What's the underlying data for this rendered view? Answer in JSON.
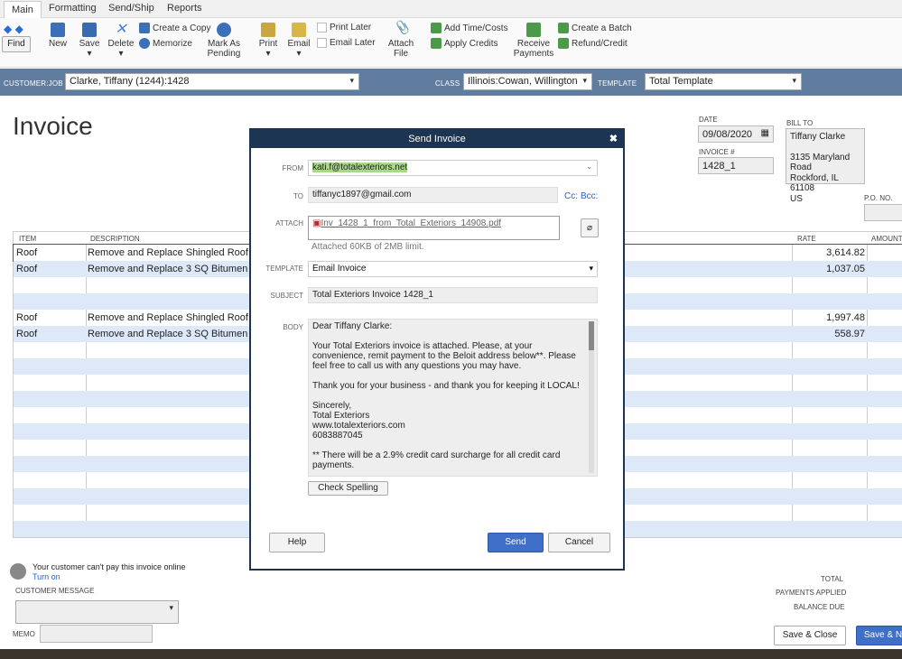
{
  "tabs": [
    "Main",
    "Formatting",
    "Send/Ship",
    "Reports"
  ],
  "ribbon": {
    "find": "Find",
    "new": "New",
    "save": "Save",
    "delete": "Delete",
    "create_copy": "Create a Copy",
    "memorize": "Memorize",
    "mark_pending": "Mark As Pending",
    "print": "Print",
    "email": "Email",
    "print_later": "Print Later",
    "email_later": "Email Later",
    "attach_file": "Attach File",
    "add_time": "Add Time/Costs",
    "apply_credits": "Apply Credits",
    "receive_payments": "Receive Payments",
    "create_batch": "Create a Batch",
    "refund_credit": "Refund/Credit"
  },
  "customer_bar": {
    "customer_job_label": "CUSTOMER:JOB",
    "customer_job": "Clarke, Tiffany (1244):1428",
    "class_label": "CLASS",
    "class": "Illinois:Cowan, Willington",
    "template_label": "TEMPLATE",
    "template": "Total Template"
  },
  "invoice": {
    "title": "Invoice",
    "date_label": "DATE",
    "date": "09/08/2020",
    "invoice_no_label": "INVOICE #",
    "invoice_no": "1428_1",
    "bill_to_label": "BILL TO",
    "bill_to": [
      "Tiffany Clarke",
      "",
      "3135 Maryland Road",
      "Rockford, IL 61108",
      "US"
    ],
    "po_label": "P.O. NO."
  },
  "table": {
    "headers": {
      "item": "ITEM",
      "description": "DESCRIPTION",
      "rate": "RATE",
      "amount": "AMOUNT"
    },
    "rows": [
      {
        "item": "Roof",
        "description": "Remove and Replace Shingled Roof. Inst",
        "rate": "3,614.82"
      },
      {
        "item": "Roof",
        "description": "Remove and Replace 3 SQ Bitumen Roof",
        "rate": "1,037.05"
      },
      {
        "item": "",
        "description": "",
        "rate": ""
      },
      {
        "item": "",
        "description": "",
        "rate": ""
      },
      {
        "item": "Roof",
        "description": "Remove and Replace Shingled Roof. Inst",
        "rate": "1,997.48"
      },
      {
        "item": "Roof",
        "description": "Remove and Replace 3 SQ Bitumen Roof",
        "rate": "558.97"
      }
    ]
  },
  "footer": {
    "online_msg": "Your customer can't pay this invoice online",
    "turn_on": "Turn on",
    "customer_message_label": "CUSTOMER MESSAGE",
    "memo_label": "MEMO",
    "total_label": "TOTAL",
    "payments_applied_label": "PAYMENTS APPLIED",
    "balance_due_label": "BALANCE DUE",
    "save_close": "Save & Close",
    "save_new": "Save & N"
  },
  "dialog": {
    "title": "Send Invoice",
    "from_label": "FROM",
    "from": "kati.f@totalexteriors.net",
    "to_label": "TO",
    "to": "tiffanyc1897@gmail.com",
    "cc": "Cc:",
    "bcc": "Bcc:",
    "attach_label": "ATTACH",
    "attachment": "Inv_1428_1_from_Total_Exteriors_14908.pdf",
    "attach_note": "Attached 60KB of 2MB limit.",
    "template_label": "TEMPLATE",
    "template": "Email Invoice",
    "subject_label": "SUBJECT",
    "subject": "Total Exteriors Invoice 1428_1",
    "body_label": "BODY",
    "body": [
      "Dear Tiffany Clarke:",
      "Your Total Exteriors invoice is attached. Please, at your convenience, remit payment to the Beloit address below**.  Please feel free to call us with any questions you may have.",
      "Thank you for your business - and thank you for keeping it LOCAL!",
      "Sincerely,\nTotal Exteriors\nwww.totalexteriors.com\n6083887045",
      "** There will be a 2.9% credit card surcharge for all credit card payments."
    ],
    "check_spelling": "Check Spelling",
    "help": "Help",
    "send": "Send",
    "cancel": "Cancel"
  },
  "colors": {
    "bar": "#607d9f",
    "dialog_header": "#1c3553",
    "send_button": "#3f6fc7",
    "row_alt": "#dde8f8"
  }
}
